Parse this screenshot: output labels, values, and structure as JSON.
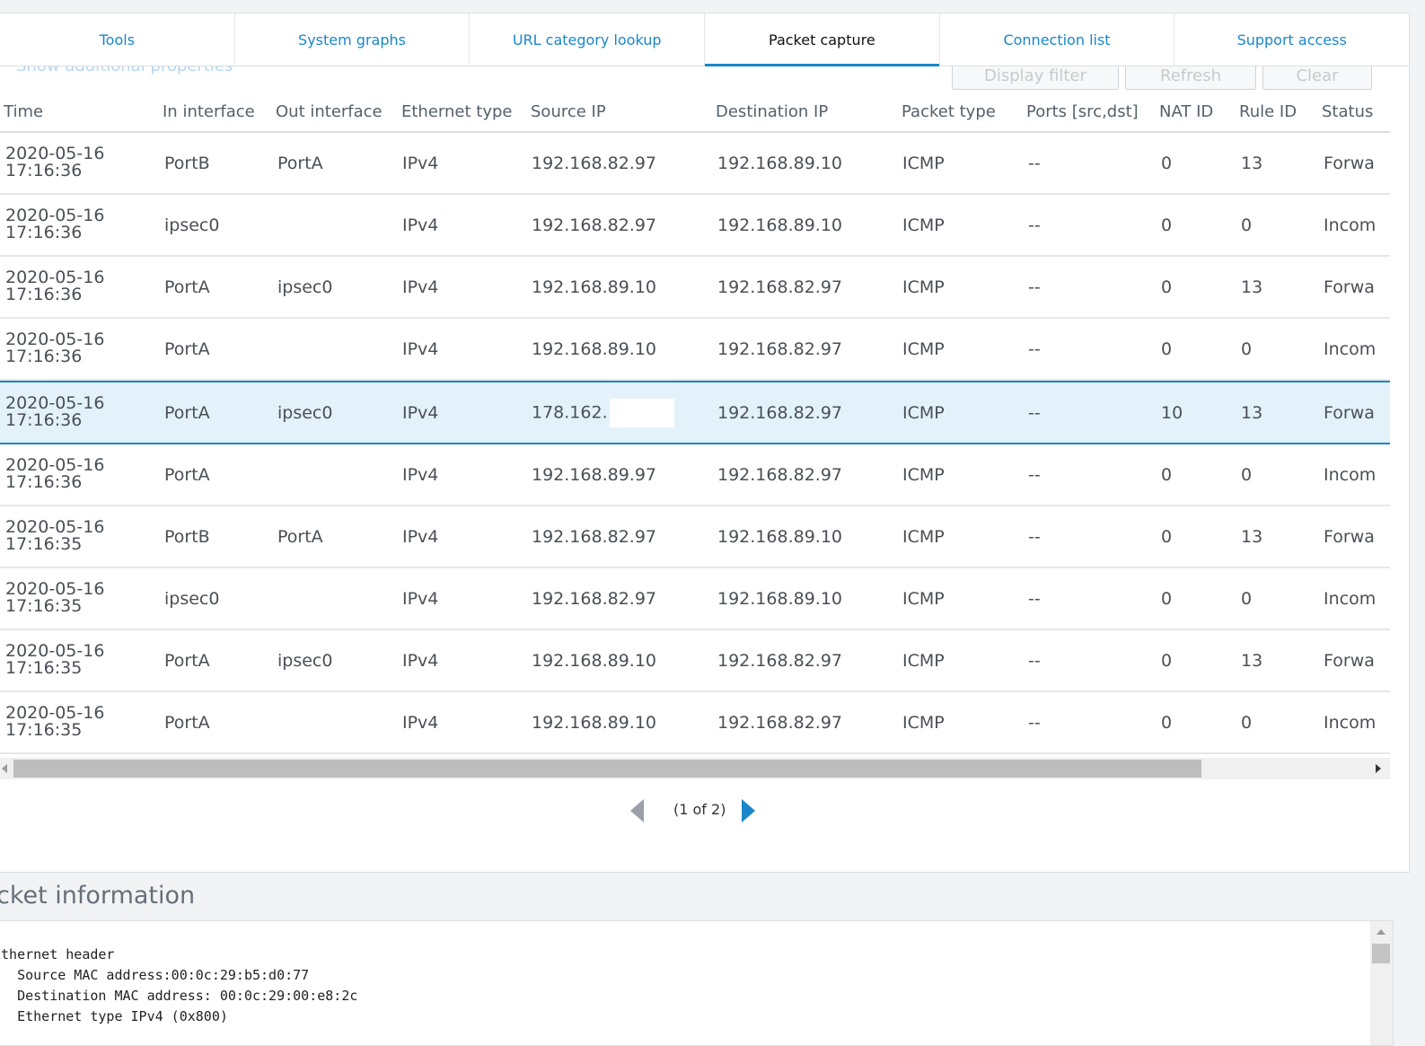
{
  "tabs": [
    {
      "label": "Tools",
      "active": false
    },
    {
      "label": "System graphs",
      "active": false
    },
    {
      "label": "URL category lookup",
      "active": false
    },
    {
      "label": "Packet capture",
      "active": true
    },
    {
      "label": "Connection list",
      "active": false
    },
    {
      "label": "Support access",
      "active": false
    }
  ],
  "toolbar": {
    "show_props": "Show additional properties",
    "display_filter": "Display filter",
    "refresh": "Refresh",
    "clear": "Clear"
  },
  "columns": [
    "Time",
    "In interface",
    "Out interface",
    "Ethernet type",
    "Source IP",
    "Destination IP",
    "Packet type",
    "Ports [src,dst]",
    "NAT ID",
    "Rule ID",
    "Status"
  ],
  "rows": [
    {
      "date": "2020-05-16",
      "time": "17:16:36",
      "in": "PortB",
      "out": "PortA",
      "eth": "IPv4",
      "src": "192.168.82.97",
      "dst": "192.168.89.10",
      "ptype": "ICMP",
      "ports": "--",
      "nat": "0",
      "rule": "13",
      "status": "Forwa"
    },
    {
      "date": "2020-05-16",
      "time": "17:16:36",
      "in": "ipsec0",
      "out": "",
      "eth": "IPv4",
      "src": "192.168.82.97",
      "dst": "192.168.89.10",
      "ptype": "ICMP",
      "ports": "--",
      "nat": "0",
      "rule": "0",
      "status": "Incom"
    },
    {
      "date": "2020-05-16",
      "time": "17:16:36",
      "in": "PortA",
      "out": "ipsec0",
      "eth": "IPv4",
      "src": "192.168.89.10",
      "dst": "192.168.82.97",
      "ptype": "ICMP",
      "ports": "--",
      "nat": "0",
      "rule": "13",
      "status": "Forwa"
    },
    {
      "date": "2020-05-16",
      "time": "17:16:36",
      "in": "PortA",
      "out": "",
      "eth": "IPv4",
      "src": "192.168.89.10",
      "dst": "192.168.82.97",
      "ptype": "ICMP",
      "ports": "--",
      "nat": "0",
      "rule": "0",
      "status": "Incom"
    },
    {
      "date": "2020-05-16",
      "time": "17:16:36",
      "in": "PortA",
      "out": "ipsec0",
      "eth": "IPv4",
      "src": "178.162.",
      "dst": "192.168.82.97",
      "ptype": "ICMP",
      "ports": "--",
      "nat": "10",
      "rule": "13",
      "status": "Forwa",
      "selected": true,
      "redacted": true
    },
    {
      "date": "2020-05-16",
      "time": "17:16:36",
      "in": "PortA",
      "out": "",
      "eth": "IPv4",
      "src": "192.168.89.97",
      "dst": "192.168.82.97",
      "ptype": "ICMP",
      "ports": "--",
      "nat": "0",
      "rule": "0",
      "status": "Incom"
    },
    {
      "date": "2020-05-16",
      "time": "17:16:35",
      "in": "PortB",
      "out": "PortA",
      "eth": "IPv4",
      "src": "192.168.82.97",
      "dst": "192.168.89.10",
      "ptype": "ICMP",
      "ports": "--",
      "nat": "0",
      "rule": "13",
      "status": "Forwa"
    },
    {
      "date": "2020-05-16",
      "time": "17:16:35",
      "in": "ipsec0",
      "out": "",
      "eth": "IPv4",
      "src": "192.168.82.97",
      "dst": "192.168.89.10",
      "ptype": "ICMP",
      "ports": "--",
      "nat": "0",
      "rule": "0",
      "status": "Incom"
    },
    {
      "date": "2020-05-16",
      "time": "17:16:35",
      "in": "PortA",
      "out": "ipsec0",
      "eth": "IPv4",
      "src": "192.168.89.10",
      "dst": "192.168.82.97",
      "ptype": "ICMP",
      "ports": "--",
      "nat": "0",
      "rule": "13",
      "status": "Forwa"
    },
    {
      "date": "2020-05-16",
      "time": "17:16:35",
      "in": "PortA",
      "out": "",
      "eth": "IPv4",
      "src": "192.168.89.10",
      "dst": "192.168.82.97",
      "ptype": "ICMP",
      "ports": "--",
      "nat": "0",
      "rule": "0",
      "status": "Incom"
    }
  ],
  "pager": {
    "label": "(1 of 2)"
  },
  "packet_info": {
    "title": "cket information",
    "lines": [
      "Ethernet header",
      "   Source MAC address:00:0c:29:b5:d0:77",
      "   Destination MAC address: 00:0c:29:00:e8:2c",
      "   Ethernet type IPv4 (0x800)"
    ]
  }
}
